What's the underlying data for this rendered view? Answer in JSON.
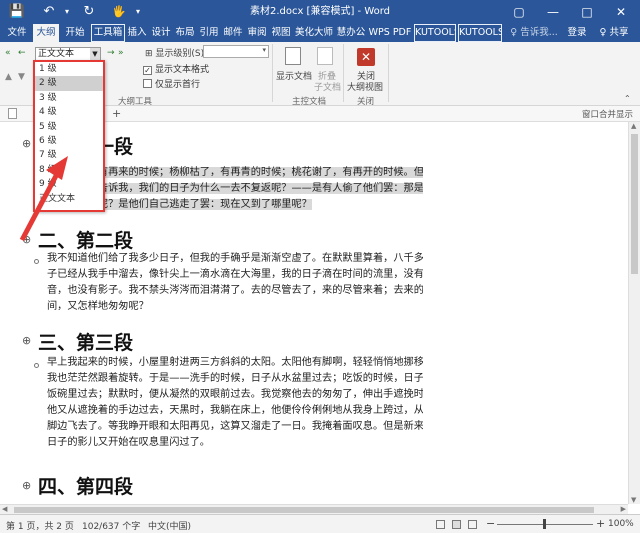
{
  "titlebar": {
    "title": "素材2.docx [兼容模式] - Word",
    "quick_access": {
      "save_icon": "💾",
      "undo_icon": "↶",
      "redo_icon": "↻",
      "touch_icon": "🖐"
    },
    "window_buttons": {
      "ribbon_options": "▢",
      "minimize": "—",
      "maximize": "□",
      "close": "✕"
    }
  },
  "menubar": {
    "tabs": [
      "文件",
      "大纲",
      "开始",
      "工具箱",
      "插入",
      "设计",
      "布局",
      "引用",
      "邮件",
      "审阅",
      "视图",
      "美化大师",
      "慧办公",
      "WPS PDF",
      "KUTOOLS",
      "KUTOOLS I"
    ],
    "tell_me": "♀ 告诉我...",
    "login": "登录",
    "share": "♀ 共享"
  },
  "ribbon": {
    "style_combo": "正文文本",
    "show_level_label": "显示级别(S):",
    "show_text_format": "显示文本格式",
    "first_line_only": "仅显示首行",
    "show_text_format_checked": true,
    "first_line_only_checked": false,
    "outline_tools_label": "大纲工具",
    "show_document_label": "显示文档",
    "collapse_subdoc_label": "折叠",
    "collapse_subdoc_label2": "子文档",
    "master_document_group": "主控文档",
    "close_label": "关闭",
    "close_label2": "大纲视图",
    "close_group": "关闭",
    "arrows": {
      "promote_first": "«",
      "promote": "←",
      "demote": "→",
      "move_up": "▲",
      "move_down": "▼",
      "expand": "+",
      "collapse": "−"
    }
  },
  "level_dropdown": {
    "items": [
      "1 级",
      "2 级",
      "3 级",
      "4 级",
      "5 级",
      "6 级",
      "7 级",
      "8 级",
      "9 级",
      "正文文本"
    ],
    "selected_index": 1
  },
  "docbar": {
    "add_tab": "+",
    "window_merge": "窗口合并显示"
  },
  "document": {
    "sections": [
      {
        "heading": "一、第一段",
        "paragraph": [
          "燕子去了，有再来的时候；杨柳枯了，有再青的时候；桃花谢了，有再开的时候。但是，",
          "聪明的，你告诉我，我们的日子为什么一去不复返呢？——是有人偷了他们罢：那是谁？",
          "又藏在何处呢？是他们自己逃走了罢：现在又到了哪里呢？"
        ]
      },
      {
        "heading": "二、第二段",
        "paragraph": [
          "我不知道他们给了我多少日子，但我的手确乎是渐渐空虚了。在默默里算着，八千多日",
          "子已经从我手中溜去，像针尖上一滴水滴在大海里，我的日子滴在时间的流里，没有声",
          "音，也没有影子。我不禁头涔涔而泪潸潸了。去的尽管去了，来的尽管来着；去来的中",
          "间，又怎样地匆匆呢？"
        ]
      },
      {
        "heading": "三、第三段",
        "paragraph": [
          "早上我起来的时候，小屋里射进两三方斜斜的太阳。太阳他有脚啊，轻轻悄悄地挪移了；",
          "我也茫茫然跟着旋转。于是——洗手的时候，日子从水盆里过去；吃饭的时候，日子从",
          "饭碗里过去；默默时，便从凝然的双眼前过去。我觉察他去的匆匆了，伸出手遮挽时，",
          "他又从遮挽着的手边过去，天黑时，我躺在床上，他便伶伶俐俐地从我身上跨过，从我",
          "脚边飞去了。等我睁开眼和太阳再见，这算又溜走了一日。我掩着面叹息。但是新来的",
          "日子的影儿又开始在叹息里闪过了。"
        ]
      },
      {
        "heading": "四、第四段",
        "paragraph": []
      }
    ]
  },
  "statusbar": {
    "page": "第 1 页，共 2 页",
    "words": "102/637 个字",
    "language": "中文(中国)",
    "zoom": "100%",
    "zoom_minus": "−",
    "zoom_plus": "+"
  },
  "colors": {
    "accent": "#2b579a",
    "highlight_border": "#e53935"
  }
}
